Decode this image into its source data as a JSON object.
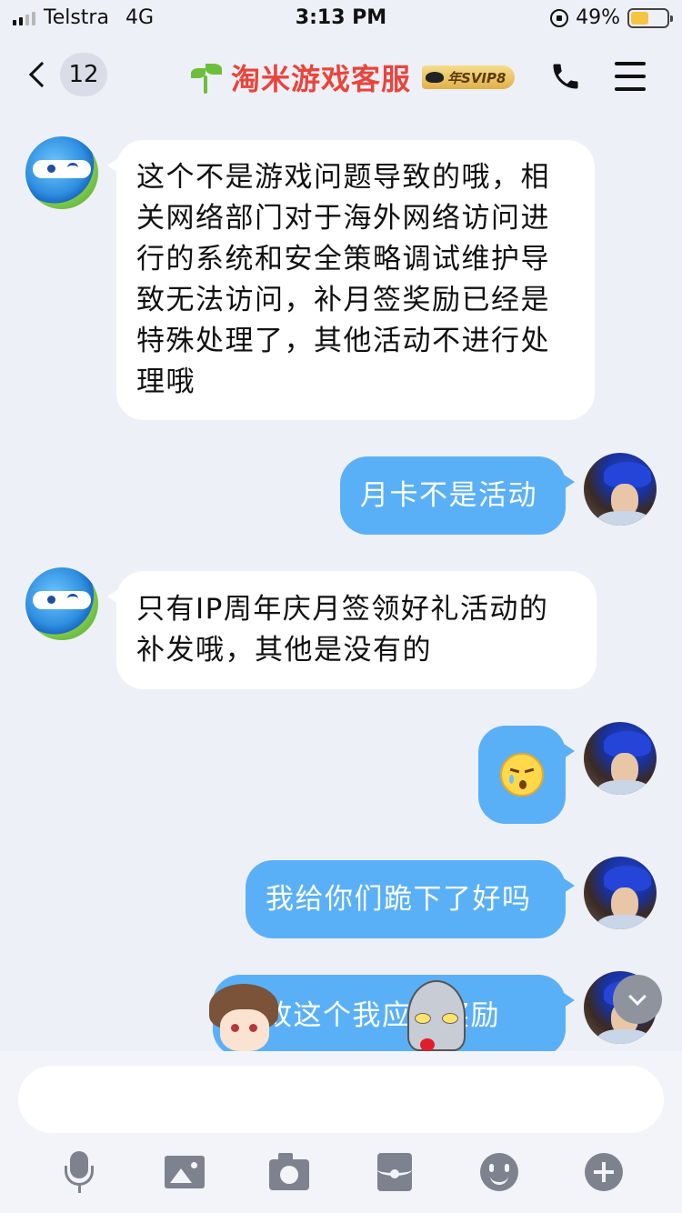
{
  "status_bar": {
    "carrier": "Telstra",
    "network": "4G",
    "time": "3:13 PM",
    "battery": "49%",
    "battery_level": 0.49
  },
  "header": {
    "back_count": "12",
    "title": "淘米游戏客服",
    "badge": "年SVIP8"
  },
  "messages": [
    {
      "side": "in",
      "text": "这个不是游戏问题导致的哦，相关网络部门对于海外网络访问进行的系统和安全策略调试维护导致无法访问，补月签奖励已经是特殊处理了，其他活动不进行处理哦"
    },
    {
      "side": "out",
      "text": "月卡不是活动"
    },
    {
      "side": "in",
      "text": "只有IP周年庆月签领好礼活动的补发哦，其他是没有的"
    },
    {
      "side": "out",
      "text": "",
      "emoji": "crying-face-emoji"
    },
    {
      "side": "out",
      "text": "我给你们跪下了好吗"
    },
    {
      "side": "out",
      "text": "这个我应得的奖励",
      "partial_visible": "故这个我应的奖励"
    }
  ],
  "icons": {
    "toolbar": [
      "microphone-icon",
      "image-icon",
      "camera-icon",
      "red-packet-icon",
      "emoji-icon",
      "plus-icon"
    ]
  },
  "colors": {
    "title": "#e8453c",
    "outgoing_bubble": "#5ab0f7",
    "incoming_bubble": "#ffffff",
    "background": "#eef0f7"
  }
}
